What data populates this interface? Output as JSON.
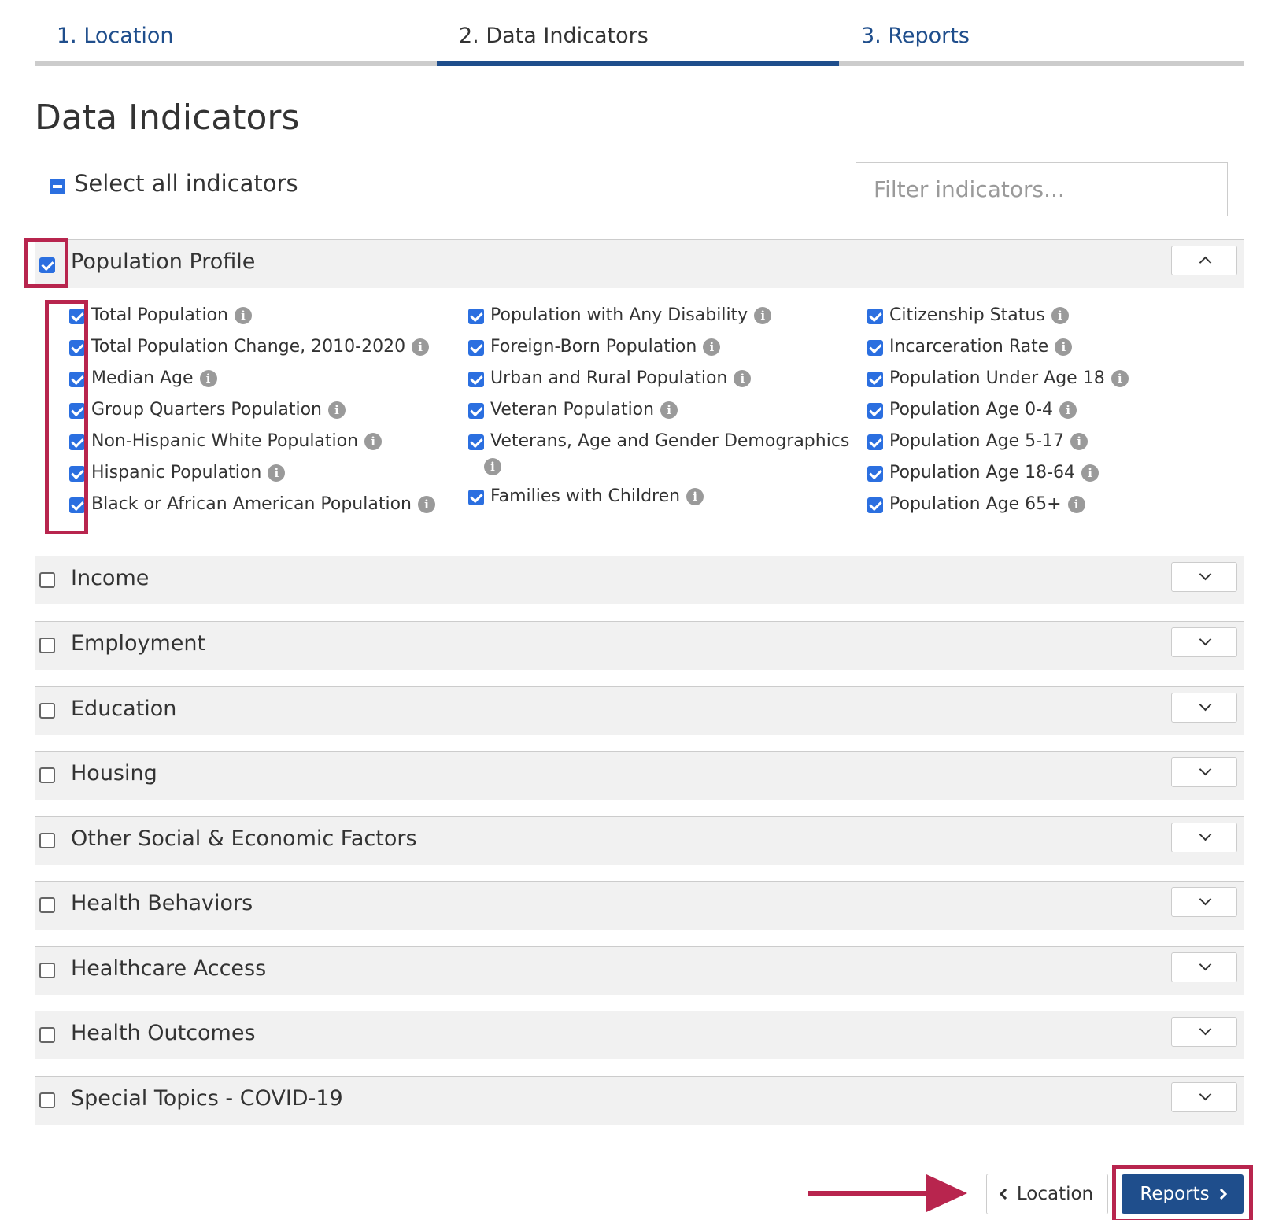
{
  "stepper": {
    "steps": [
      {
        "label": "1. Location"
      },
      {
        "label": "2. Data Indicators"
      },
      {
        "label": "3. Reports"
      }
    ]
  },
  "page": {
    "title": "Data Indicators"
  },
  "select_all": {
    "label": "Select all indicators"
  },
  "filter": {
    "placeholder": "Filter indicators..."
  },
  "expanded_category": {
    "label": "Population Profile",
    "columns": [
      [
        "Total Population",
        "Total Population Change, 2010-2020",
        "Median Age",
        "Group Quarters Population",
        "Non-Hispanic White Population",
        "Hispanic Population",
        "Black or African American Population"
      ],
      [
        "Population with Any Disability",
        "Foreign-Born Population",
        "Urban and Rural Population",
        "Veteran Population",
        "Veterans, Age and Gender Demographics",
        "Families with Children"
      ],
      [
        "Citizenship Status",
        "Incarceration Rate",
        "Population Under Age 18",
        "Population Age 0-4",
        "Population Age 5-17",
        "Population Age 18-64",
        "Population Age 65+"
      ]
    ]
  },
  "categories": [
    {
      "label": "Income"
    },
    {
      "label": "Employment"
    },
    {
      "label": "Education"
    },
    {
      "label": "Housing"
    },
    {
      "label": "Other Social & Economic Factors"
    },
    {
      "label": "Health Behaviors"
    },
    {
      "label": "Healthcare Access"
    },
    {
      "label": "Health Outcomes"
    },
    {
      "label": "Special Topics - COVID-19"
    }
  ],
  "nav": {
    "prev_label": "Location",
    "next_label": "Reports"
  },
  "info_glyph": "i",
  "colors": {
    "primary": "#1f4e8c",
    "checkbox": "#2b6fe0",
    "highlight": "#b8254e"
  }
}
